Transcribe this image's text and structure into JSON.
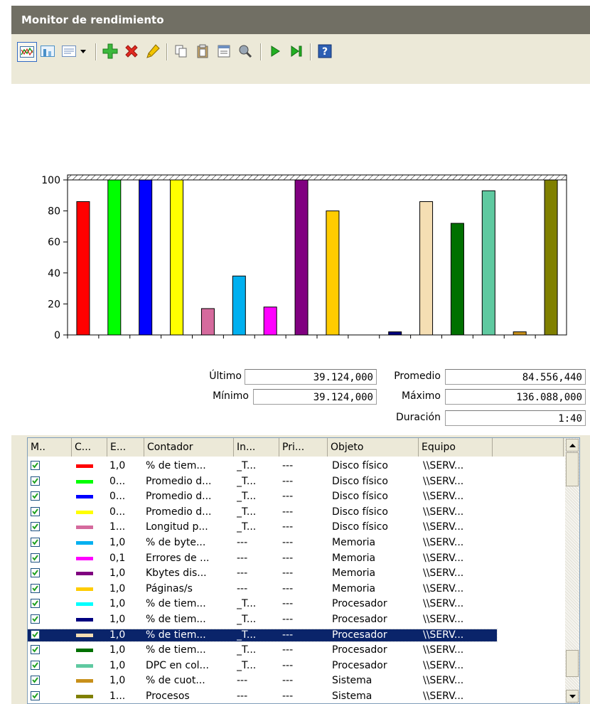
{
  "window": {
    "title": "Monitor de rendimiento"
  },
  "toolbar": {
    "buttons": [
      {
        "name": "view-graph-icon",
        "color": "#3a6ea5"
      },
      {
        "name": "view-histogram-icon",
        "color": "#4a90c8"
      },
      {
        "name": "view-report-icon",
        "color": "#6c8ebf"
      },
      {
        "name": "dropdown-arrow-icon",
        "color": "#000000"
      },
      {
        "name": "add-counter-icon",
        "color": "#2ea02e"
      },
      {
        "name": "delete-counter-icon",
        "color": "#d0231b"
      },
      {
        "name": "highlight-icon",
        "color": "#e8b400"
      },
      {
        "name": "copy-properties-icon",
        "color": "#6a6a6a"
      },
      {
        "name": "paste-counter-list-icon",
        "color": "#6a6a6a"
      },
      {
        "name": "properties-icon",
        "color": "#6a6a6a"
      },
      {
        "name": "zoom-icon",
        "color": "#6a6a6a"
      },
      {
        "name": "unfreeze-display-icon",
        "color": "#1aa31a"
      },
      {
        "name": "update-data-icon",
        "color": "#1aa31a"
      },
      {
        "name": "help-icon",
        "color": "#1e4fa3"
      }
    ]
  },
  "chart_data": {
    "type": "bar",
    "ylim": [
      0,
      100
    ],
    "yticks": [
      "0",
      "20",
      "40",
      "60",
      "80",
      "100"
    ],
    "grid": false,
    "bars": [
      {
        "value": 86,
        "color": "#ff0000"
      },
      {
        "value": 100,
        "color": "#00ff00"
      },
      {
        "value": 100,
        "color": "#0000ff"
      },
      {
        "value": 100,
        "color": "#ffff00"
      },
      {
        "value": 17,
        "color": "#d56a9d"
      },
      {
        "value": 38,
        "color": "#00b0f0"
      },
      {
        "value": 18,
        "color": "#ff00ff"
      },
      {
        "value": 100,
        "color": "#800080"
      },
      {
        "value": 80,
        "color": "#ffcc00"
      },
      {
        "value": 0,
        "color": "#00ffff"
      },
      {
        "value": 2,
        "color": "#000080"
      },
      {
        "value": 86,
        "color": "#f5deb3"
      },
      {
        "value": 72,
        "color": "#007000"
      },
      {
        "value": 93,
        "color": "#5fc9a0"
      },
      {
        "value": 2,
        "color": "#c8901a"
      },
      {
        "value": 100,
        "color": "#808000"
      }
    ]
  },
  "stats": {
    "last_label": "Último",
    "last_value": "39.124,000",
    "avg_label": "Promedio",
    "avg_value": "84.556,440",
    "min_label": "Mínimo",
    "min_value": "39.124,000",
    "max_label": "Máximo",
    "max_value": "136.088,000",
    "duration_label": "Duración",
    "duration_value": "1:40"
  },
  "list": {
    "columns": [
      "M..",
      "C...",
      "E...",
      "Contador",
      "In...",
      "Pri...",
      "Objeto",
      "Equipo"
    ],
    "rows": [
      {
        "color": "#ff0000",
        "scale": "1,0",
        "counter": "% de tiem...",
        "instance": "_T...",
        "parent": "---",
        "object": "Disco físico",
        "computer": "\\\\SERV..."
      },
      {
        "color": "#00ff00",
        "scale": "0...",
        "counter": "Promedio d...",
        "instance": "_T...",
        "parent": "---",
        "object": "Disco físico",
        "computer": "\\\\SERV..."
      },
      {
        "color": "#0000ff",
        "scale": "0...",
        "counter": "Promedio d...",
        "instance": "_T...",
        "parent": "---",
        "object": "Disco físico",
        "computer": "\\\\SERV..."
      },
      {
        "color": "#ffff00",
        "scale": "0...",
        "counter": "Promedio d...",
        "instance": "_T...",
        "parent": "---",
        "object": "Disco físico",
        "computer": "\\\\SERV..."
      },
      {
        "color": "#d56a9d",
        "scale": "1...",
        "counter": "Longitud p...",
        "instance": "_T...",
        "parent": "---",
        "object": "Disco físico",
        "computer": "\\\\SERV..."
      },
      {
        "color": "#00b0f0",
        "scale": "1,0",
        "counter": "% de byte...",
        "instance": "---",
        "parent": "---",
        "object": "Memoria",
        "computer": "\\\\SERV..."
      },
      {
        "color": "#ff00ff",
        "scale": "0,1",
        "counter": "Errores de ...",
        "instance": "---",
        "parent": "---",
        "object": "Memoria",
        "computer": "\\\\SERV..."
      },
      {
        "color": "#800080",
        "scale": "1,0",
        "counter": "Kbytes dis...",
        "instance": "---",
        "parent": "---",
        "object": "Memoria",
        "computer": "\\\\SERV..."
      },
      {
        "color": "#ffcc00",
        "scale": "1,0",
        "counter": "Páginas/s",
        "instance": "---",
        "parent": "---",
        "object": "Memoria",
        "computer": "\\\\SERV..."
      },
      {
        "color": "#00ffff",
        "scale": "1,0",
        "counter": "% de tiem...",
        "instance": "_T...",
        "parent": "---",
        "object": "Procesador",
        "computer": "\\\\SERV..."
      },
      {
        "color": "#000080",
        "scale": "1,0",
        "counter": "% de tiem...",
        "instance": "_T...",
        "parent": "---",
        "object": "Procesador",
        "computer": "\\\\SERV..."
      },
      {
        "color": "#f5deb3",
        "scale": "1,0",
        "counter": "% de tiem...",
        "instance": "_T...",
        "parent": "---",
        "object": "Procesador",
        "computer": "\\\\SERV...",
        "selected": true
      },
      {
        "color": "#007000",
        "scale": "1,0",
        "counter": "% de tiem...",
        "instance": "_T...",
        "parent": "---",
        "object": "Procesador",
        "computer": "\\\\SERV..."
      },
      {
        "color": "#5fc9a0",
        "scale": "1,0",
        "counter": "DPC en col...",
        "instance": "_T...",
        "parent": "---",
        "object": "Procesador",
        "computer": "\\\\SERV..."
      },
      {
        "color": "#c8901a",
        "scale": "1,0",
        "counter": "% de cuot...",
        "instance": "---",
        "parent": "---",
        "object": "Sistema",
        "computer": "\\\\SERV..."
      },
      {
        "color": "#808000",
        "scale": "1...",
        "counter": "Procesos",
        "instance": "---",
        "parent": "---",
        "object": "Sistema",
        "computer": "\\\\SERV..."
      }
    ]
  }
}
